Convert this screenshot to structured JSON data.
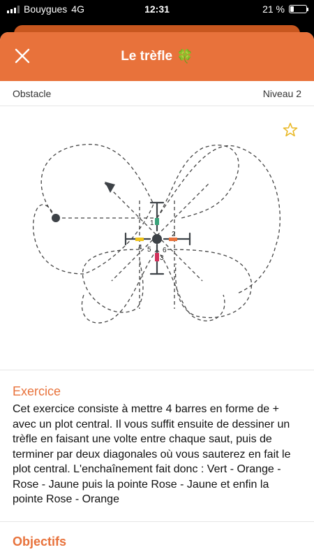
{
  "status_bar": {
    "carrier": "Bouygues",
    "network": "4G",
    "time": "12:31",
    "battery": "21 %",
    "battery_level": 0.21
  },
  "header": {
    "title": "Le trèfle",
    "title_icon": "🍀",
    "close_icon": "close-icon",
    "background": "#e8723b"
  },
  "meta": {
    "category": "Obstacle",
    "level": "Niveau 2"
  },
  "favorite_icon": "star-outline-icon",
  "diagram": {
    "labels": [
      "1",
      "2",
      "3",
      "4",
      "5",
      "6"
    ],
    "bar_colors": {
      "green": "#3aa37a",
      "orange": "#e8723b",
      "pink": "#d2315c",
      "yellow": "#f0c419"
    }
  },
  "exercise": {
    "heading": "Exercice",
    "text": "Cet exercice consiste à mettre 4 barres en forme de + avec un plot central. Il vous suffit ensuite de dessiner un trèfle en faisant une volte entre chaque saut, puis de terminer par deux diagonales où vous sauterez en fait le plot central. L'enchaînement fait donc : Vert - Orange - Rose - Jaune puis la pointe Rose - Jaune et enfin la pointe Rose - Orange"
  },
  "objectives": {
    "heading": "Objectifs"
  }
}
